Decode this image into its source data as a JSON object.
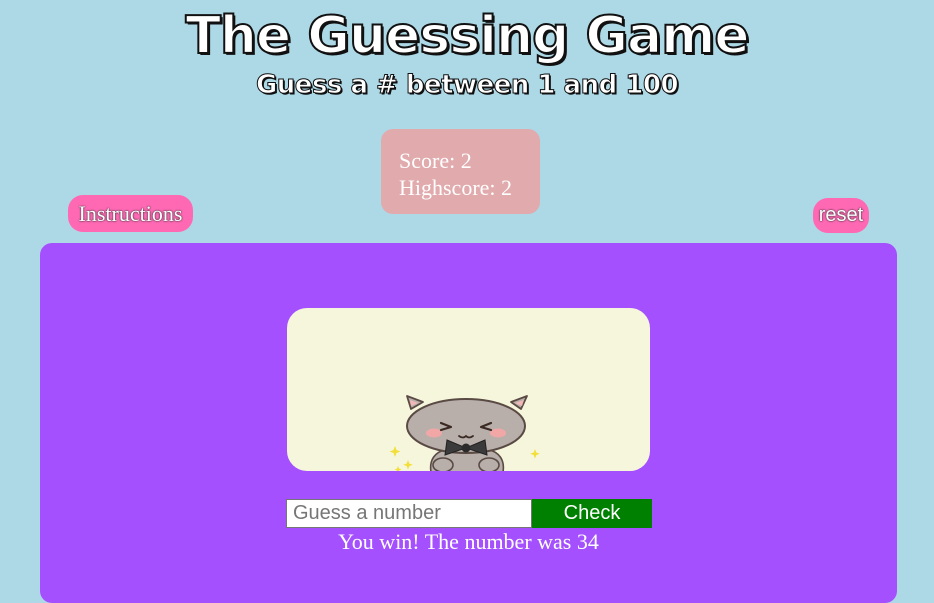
{
  "header": {
    "title": "The Guessing Game",
    "subtitle": "Guess a # between 1 and 100"
  },
  "score_box": {
    "score_text": "Score: 2",
    "highscore_text": "Highscore: 2"
  },
  "buttons": {
    "instructions_label": "Instructions",
    "reset_label": "reset",
    "check_label": "Check"
  },
  "guess_input": {
    "value": "",
    "placeholder": "Guess a number"
  },
  "result_message": "You win! The number was 34",
  "image": {
    "icon": "cute-cat-with-bowtie-icon"
  },
  "colors": {
    "page_background": "#add8e6",
    "score_box": "#e1aaad",
    "pill_buttons": "#ff69b4",
    "panel": "#a450ff",
    "image_card": "#f6f6dc",
    "check_button": "#008000"
  }
}
